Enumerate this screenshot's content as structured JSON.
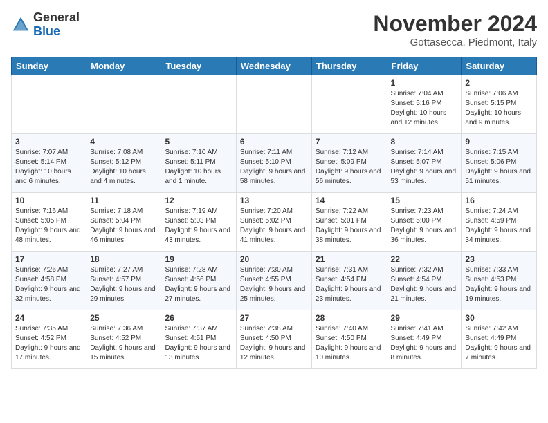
{
  "header": {
    "logo_line1": "General",
    "logo_line2": "Blue",
    "month_title": "November 2024",
    "location": "Gottasecca, Piedmont, Italy"
  },
  "weekdays": [
    "Sunday",
    "Monday",
    "Tuesday",
    "Wednesday",
    "Thursday",
    "Friday",
    "Saturday"
  ],
  "weeks": [
    [
      {
        "day": "",
        "info": ""
      },
      {
        "day": "",
        "info": ""
      },
      {
        "day": "",
        "info": ""
      },
      {
        "day": "",
        "info": ""
      },
      {
        "day": "",
        "info": ""
      },
      {
        "day": "1",
        "info": "Sunrise: 7:04 AM\nSunset: 5:16 PM\nDaylight: 10 hours and 12 minutes."
      },
      {
        "day": "2",
        "info": "Sunrise: 7:06 AM\nSunset: 5:15 PM\nDaylight: 10 hours and 9 minutes."
      }
    ],
    [
      {
        "day": "3",
        "info": "Sunrise: 7:07 AM\nSunset: 5:14 PM\nDaylight: 10 hours and 6 minutes."
      },
      {
        "day": "4",
        "info": "Sunrise: 7:08 AM\nSunset: 5:12 PM\nDaylight: 10 hours and 4 minutes."
      },
      {
        "day": "5",
        "info": "Sunrise: 7:10 AM\nSunset: 5:11 PM\nDaylight: 10 hours and 1 minute."
      },
      {
        "day": "6",
        "info": "Sunrise: 7:11 AM\nSunset: 5:10 PM\nDaylight: 9 hours and 58 minutes."
      },
      {
        "day": "7",
        "info": "Sunrise: 7:12 AM\nSunset: 5:09 PM\nDaylight: 9 hours and 56 minutes."
      },
      {
        "day": "8",
        "info": "Sunrise: 7:14 AM\nSunset: 5:07 PM\nDaylight: 9 hours and 53 minutes."
      },
      {
        "day": "9",
        "info": "Sunrise: 7:15 AM\nSunset: 5:06 PM\nDaylight: 9 hours and 51 minutes."
      }
    ],
    [
      {
        "day": "10",
        "info": "Sunrise: 7:16 AM\nSunset: 5:05 PM\nDaylight: 9 hours and 48 minutes."
      },
      {
        "day": "11",
        "info": "Sunrise: 7:18 AM\nSunset: 5:04 PM\nDaylight: 9 hours and 46 minutes."
      },
      {
        "day": "12",
        "info": "Sunrise: 7:19 AM\nSunset: 5:03 PM\nDaylight: 9 hours and 43 minutes."
      },
      {
        "day": "13",
        "info": "Sunrise: 7:20 AM\nSunset: 5:02 PM\nDaylight: 9 hours and 41 minutes."
      },
      {
        "day": "14",
        "info": "Sunrise: 7:22 AM\nSunset: 5:01 PM\nDaylight: 9 hours and 38 minutes."
      },
      {
        "day": "15",
        "info": "Sunrise: 7:23 AM\nSunset: 5:00 PM\nDaylight: 9 hours and 36 minutes."
      },
      {
        "day": "16",
        "info": "Sunrise: 7:24 AM\nSunset: 4:59 PM\nDaylight: 9 hours and 34 minutes."
      }
    ],
    [
      {
        "day": "17",
        "info": "Sunrise: 7:26 AM\nSunset: 4:58 PM\nDaylight: 9 hours and 32 minutes."
      },
      {
        "day": "18",
        "info": "Sunrise: 7:27 AM\nSunset: 4:57 PM\nDaylight: 9 hours and 29 minutes."
      },
      {
        "day": "19",
        "info": "Sunrise: 7:28 AM\nSunset: 4:56 PM\nDaylight: 9 hours and 27 minutes."
      },
      {
        "day": "20",
        "info": "Sunrise: 7:30 AM\nSunset: 4:55 PM\nDaylight: 9 hours and 25 minutes."
      },
      {
        "day": "21",
        "info": "Sunrise: 7:31 AM\nSunset: 4:54 PM\nDaylight: 9 hours and 23 minutes."
      },
      {
        "day": "22",
        "info": "Sunrise: 7:32 AM\nSunset: 4:54 PM\nDaylight: 9 hours and 21 minutes."
      },
      {
        "day": "23",
        "info": "Sunrise: 7:33 AM\nSunset: 4:53 PM\nDaylight: 9 hours and 19 minutes."
      }
    ],
    [
      {
        "day": "24",
        "info": "Sunrise: 7:35 AM\nSunset: 4:52 PM\nDaylight: 9 hours and 17 minutes."
      },
      {
        "day": "25",
        "info": "Sunrise: 7:36 AM\nSunset: 4:52 PM\nDaylight: 9 hours and 15 minutes."
      },
      {
        "day": "26",
        "info": "Sunrise: 7:37 AM\nSunset: 4:51 PM\nDaylight: 9 hours and 13 minutes."
      },
      {
        "day": "27",
        "info": "Sunrise: 7:38 AM\nSunset: 4:50 PM\nDaylight: 9 hours and 12 minutes."
      },
      {
        "day": "28",
        "info": "Sunrise: 7:40 AM\nSunset: 4:50 PM\nDaylight: 9 hours and 10 minutes."
      },
      {
        "day": "29",
        "info": "Sunrise: 7:41 AM\nSunset: 4:49 PM\nDaylight: 9 hours and 8 minutes."
      },
      {
        "day": "30",
        "info": "Sunrise: 7:42 AM\nSunset: 4:49 PM\nDaylight: 9 hours and 7 minutes."
      }
    ]
  ]
}
